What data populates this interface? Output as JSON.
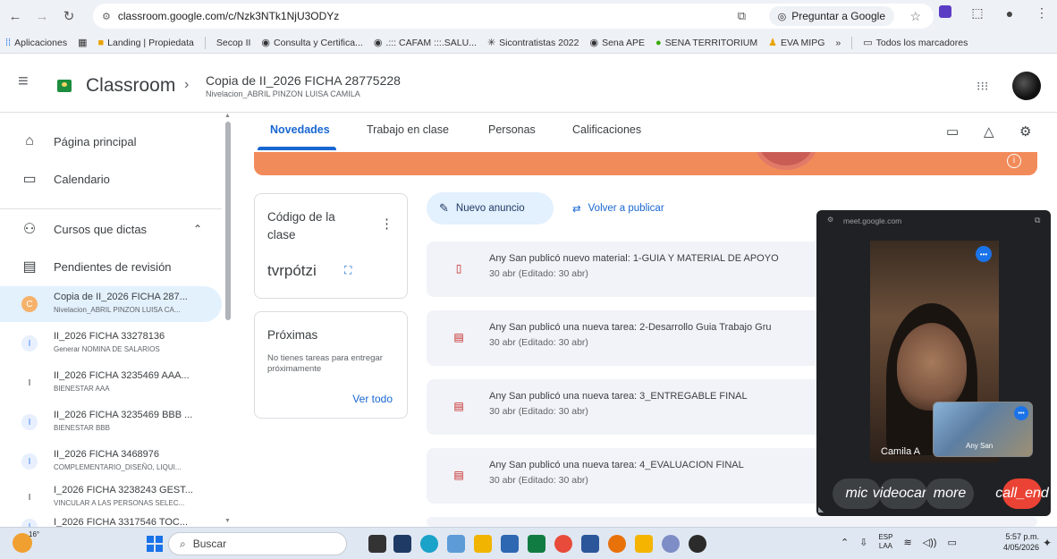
{
  "browser": {
    "url": "classroom.google.com/c/Nzk3NTk1NjU3ODYz",
    "ask_google": "Preguntar a Google",
    "bookmarks": [
      "Aplicaciones",
      "Landing | Propiedata",
      "Secop II",
      "Consulta y Certifica...",
      ".::: CAFAM :::.SALU...",
      "Sicontratistas 2022",
      "Sena APE",
      "SENA TERRITORIUM",
      "EVA MIPG"
    ],
    "bookmarks_more": "»",
    "all_bookmarks": "Todos los marcadores"
  },
  "header": {
    "brand": "Classroom",
    "course_title": "Copia de II_2026 FICHA 28775228",
    "course_subtitle": "Nivelacion_ABRIL PINZON LUISA CAMILA"
  },
  "sidebar": {
    "home": "Página principal",
    "calendar": "Calendario",
    "teaching": "Cursos que dictas",
    "pending": "Pendientes de revisión",
    "courses": [
      {
        "badge": "C",
        "color": "#4285f4",
        "title": "Copia de II_2026 FICHA 287...",
        "subtitle": "Nivelacion_ABRIL PINZON LUISA CA..."
      },
      {
        "badge": "I",
        "color": "#7baaf7",
        "title": "II_2026 FICHA 33278136",
        "subtitle": "Generar NOMINA DE SALARIOS"
      },
      {
        "badge": "I",
        "color": "#5f6368",
        "title": "II_2026 FICHA 3235469 AAA...",
        "subtitle": "BIENESTAR AAA"
      },
      {
        "badge": "I",
        "color": "#7baaf7",
        "title": "II_2026 FICHA 3235469 BBB ...",
        "subtitle": "BIENESTAR BBB"
      },
      {
        "badge": "I",
        "color": "#7baaf7",
        "title": "II_2026 FICHA 3468976",
        "subtitle": "COMPLEMENTARIO_DISEÑO, LIQUI..."
      },
      {
        "badge": "I",
        "color": "#5f6368",
        "title": "I_2026 FICHA 3238243 GEST...",
        "subtitle": "VINCULAR A LAS PERSONAS SELEC..."
      },
      {
        "badge": "I",
        "color": "#7baaf7",
        "title": "I_2026 FICHA 3317546 TOC...",
        "subtitle": ""
      }
    ]
  },
  "tabs": [
    "Novedades",
    "Trabajo en clase",
    "Personas",
    "Calificaciones"
  ],
  "class_code": {
    "title": "Código de la clase",
    "value": "tvrpótzi"
  },
  "upcoming": {
    "title": "Próximas",
    "text": "No tienes tareas para entregar próximamente",
    "link": "Ver todo"
  },
  "actions": {
    "new_announcement": "Nuevo anuncio",
    "republish": "Volver a publicar"
  },
  "posts": [
    {
      "type": "material",
      "title": "Any San publicó nuevo material: 1-GUIA Y MATERIAL DE APOYO",
      "date": "30 abr (Editado: 30 abr)"
    },
    {
      "type": "task",
      "title": "Any San publicó una nueva tarea: 2-Desarrollo Guia Trabajo Gru",
      "date": "30 abr (Editado: 30 abr)"
    },
    {
      "type": "task",
      "title": "Any San publicó una nueva tarea: 3_ENTREGABLE FINAL",
      "date": "30 abr (Editado: 30 abr)"
    },
    {
      "type": "task",
      "title": "Any San publicó una nueva tarea: 4_EVALUACION FINAL",
      "date": "30 abr (Editado: 30 abr)"
    }
  ],
  "meet": {
    "url": "meet.google.com",
    "participant": "Camila A",
    "self": "Any San",
    "controls": [
      "mic",
      "videocam",
      "more",
      "call_end"
    ]
  },
  "taskbar": {
    "temp": "16°",
    "search": "Buscar",
    "lang": "ESP",
    "lang2": "LAA",
    "time": "5:57 p.m.",
    "date": "4/05/2026"
  }
}
